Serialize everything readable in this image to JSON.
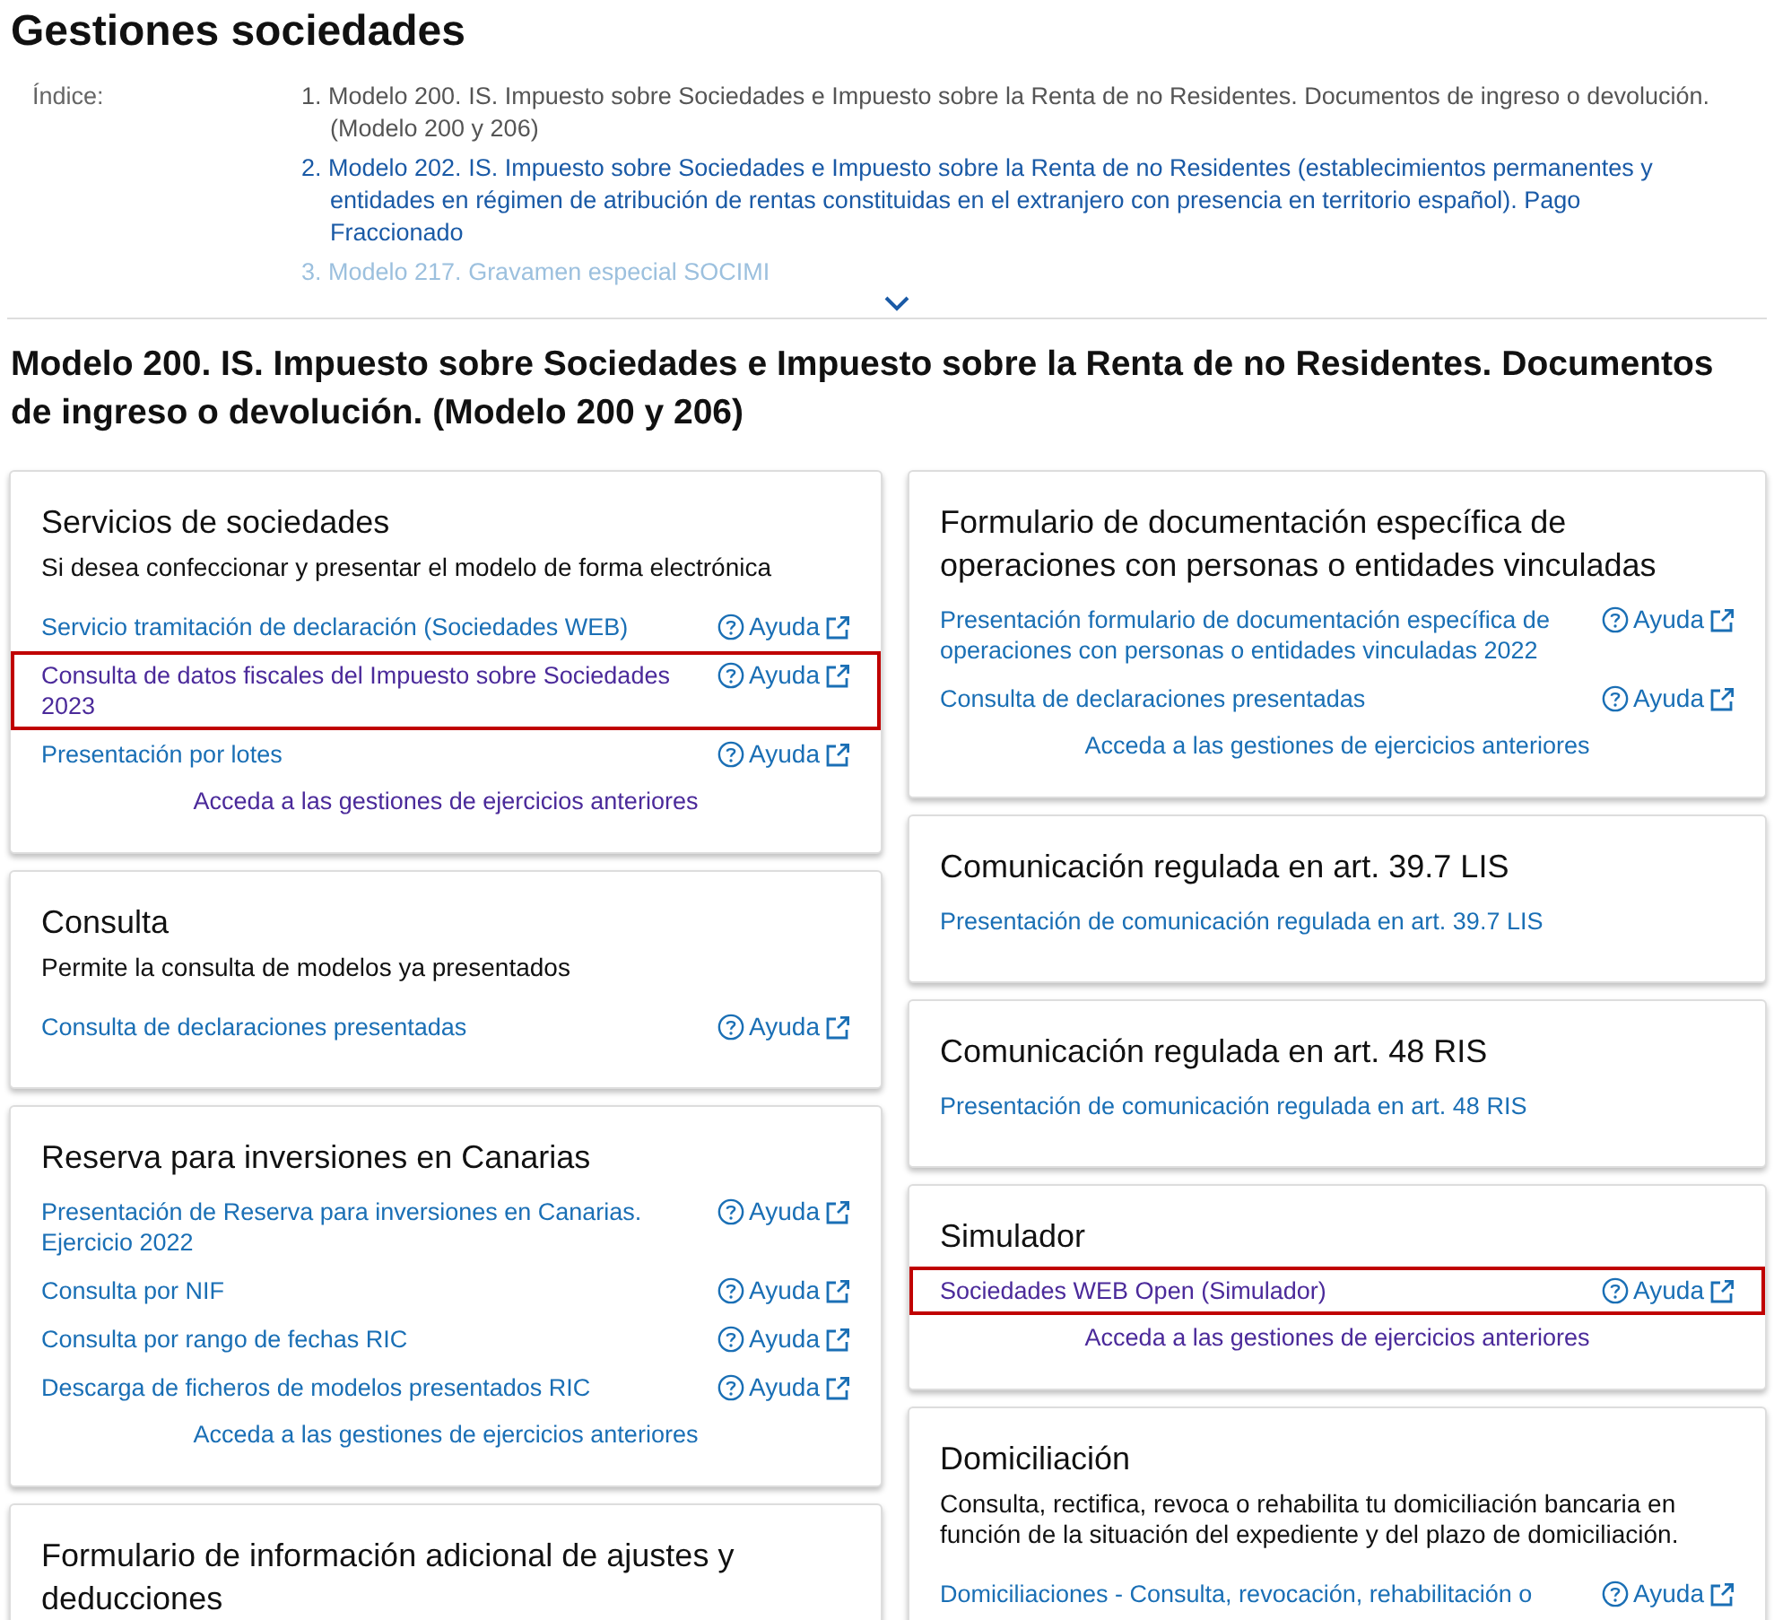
{
  "page_title": "Gestiones sociedades",
  "index": {
    "label": "Índice:",
    "items": [
      {
        "number": "1.",
        "text": "Modelo 200. IS. Impuesto sobre Sociedades e Impuesto sobre la Renta de no Residentes. Documentos de ingreso o devolución. (Modelo 200 y 206)",
        "visited": true,
        "faded": false
      },
      {
        "number": "2.",
        "text": "Modelo 202. IS. Impuesto sobre Sociedades e Impuesto sobre la Renta de no Residentes (establecimientos permanentes y entidades en régimen de atribución de rentas constituidas en el extranjero con presencia en territorio español). Pago Fraccionado",
        "visited": false,
        "faded": false
      },
      {
        "number": "3.",
        "text": "Modelo 217. Gravamen especial SOCIMI",
        "visited": false,
        "faded": true
      }
    ],
    "expanded": false
  },
  "section_title": "Modelo 200. IS. Impuesto sobre Sociedades e Impuesto sobre la Renta de no Residentes. Documentos de ingreso o devolución. (Modelo 200 y 206)",
  "columns": [
    {
      "cards": [
        {
          "title": "Servicios de sociedades",
          "description": "Si desea confeccionar y presentar el modelo de forma electrónica",
          "links": [
            {
              "text": "Servicio tramitación de declaración (Sociedades WEB)",
              "help": "Ayuda",
              "visited": false,
              "highlighted": false
            },
            {
              "text": "Consulta de datos fiscales del Impuesto sobre Sociedades 2023",
              "help": "Ayuda",
              "visited": true,
              "highlighted": true
            },
            {
              "text": "Presentación por lotes",
              "help": "Ayuda",
              "visited": false,
              "highlighted": false
            }
          ],
          "more": {
            "text": "Acceda a las gestiones de ejercicios anteriores",
            "visited": true
          }
        },
        {
          "title": "Consulta",
          "description": "Permite la consulta de modelos ya presentados",
          "links": [
            {
              "text": "Consulta de declaraciones presentadas",
              "help": "Ayuda",
              "visited": false,
              "highlighted": false
            }
          ]
        },
        {
          "title": "Reserva para inversiones en Canarias",
          "links": [
            {
              "text": "Presentación de Reserva para inversiones en Canarias. Ejercicio 2022",
              "help": "Ayuda",
              "visited": false,
              "highlighted": false
            },
            {
              "text": "Consulta por NIF",
              "help": "Ayuda",
              "visited": false,
              "highlighted": false
            },
            {
              "text": "Consulta por rango de fechas RIC",
              "help": "Ayuda",
              "visited": false,
              "highlighted": false
            },
            {
              "text": "Descarga de ficheros de modelos presentados RIC",
              "help": "Ayuda",
              "visited": false,
              "highlighted": false
            }
          ],
          "more": {
            "text": "Acceda a las gestiones de ejercicios anteriores",
            "visited": false
          }
        },
        {
          "title": "Formulario de información adicional de ajustes y deducciones"
        }
      ]
    },
    {
      "cards": [
        {
          "title": "Formulario de documentación específica de operaciones con personas o entidades vinculadas",
          "links": [
            {
              "text": "Presentación formulario de documentación específica de operaciones con personas o entidades vinculadas 2022",
              "help": "Ayuda",
              "visited": false,
              "highlighted": false
            },
            {
              "text": "Consulta de declaraciones presentadas",
              "help": "Ayuda",
              "visited": false,
              "highlighted": false
            }
          ],
          "more": {
            "text": "Acceda a las gestiones de ejercicios anteriores",
            "visited": false
          }
        },
        {
          "title": "Comunicación regulada en art. 39.7 LIS",
          "links": [
            {
              "text": "Presentación de comunicación regulada en art. 39.7 LIS",
              "visited": false,
              "highlighted": false
            }
          ]
        },
        {
          "title": "Comunicación regulada en art. 48 RIS",
          "links": [
            {
              "text": "Presentación de comunicación regulada en art. 48 RIS",
              "visited": false,
              "highlighted": false
            }
          ]
        },
        {
          "title": "Simulador",
          "links": [
            {
              "text": "Sociedades WEB Open (Simulador)",
              "help": "Ayuda",
              "visited": true,
              "highlighted": true
            }
          ],
          "more": {
            "text": "Acceda a las gestiones de ejercicios anteriores",
            "visited": true
          }
        },
        {
          "title": "Domiciliación",
          "description": "Consulta, rectifica, revoca o rehabilita tu domiciliación bancaria en función de la situación del expediente y del plazo de domiciliación.",
          "links": [
            {
              "text": "Domiciliaciones - Consulta, revocación, rehabilitación o",
              "help": "Ayuda",
              "visited": false,
              "highlighted": false
            }
          ]
        }
      ]
    }
  ]
}
